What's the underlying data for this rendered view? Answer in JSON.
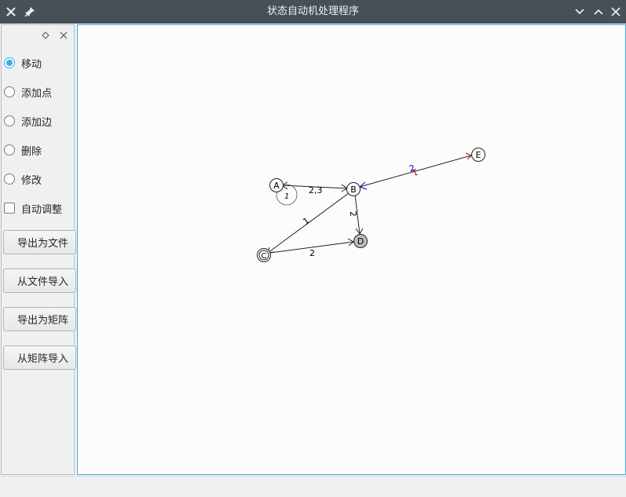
{
  "window": {
    "title": "状态自动机处理程序"
  },
  "icons": {
    "close": "close-icon",
    "pin": "pin-icon",
    "minimize": "chevron-down-icon",
    "maximize": "chevron-up-icon",
    "window_close": "close-icon",
    "dock_float": "diamond-icon",
    "dock_close": "close-icon"
  },
  "dock": {
    "modes": [
      {
        "label": "移动",
        "checked": true
      },
      {
        "label": "添加点",
        "checked": false
      },
      {
        "label": "添加边",
        "checked": false
      },
      {
        "label": "删除",
        "checked": false
      },
      {
        "label": "修改",
        "checked": false
      }
    ],
    "auto_adjust": {
      "label": "自动调整",
      "checked": false
    },
    "buttons": [
      "导出为文件",
      "从文件导入",
      "导出为矩阵",
      "从矩阵导入"
    ]
  },
  "graph": {
    "nodes": [
      {
        "id": "A",
        "label": "A",
        "filled": false,
        "accepting": false
      },
      {
        "id": "B",
        "label": "B",
        "filled": false,
        "accepting": false
      },
      {
        "id": "C",
        "label": "C",
        "filled": false,
        "accepting": true
      },
      {
        "id": "D",
        "label": "D",
        "filled": true,
        "accepting": false
      },
      {
        "id": "E",
        "label": "E",
        "filled": false,
        "accepting": false
      }
    ],
    "edges": [
      {
        "from": "A",
        "to": "B",
        "label": "2,3",
        "bidirectional": true
      },
      {
        "from": "A",
        "to": "A",
        "label": "1",
        "self_loop": true
      },
      {
        "from": "B",
        "to": "C",
        "label": "1"
      },
      {
        "from": "B",
        "to": "D",
        "label": "2"
      },
      {
        "from": "C",
        "to": "D",
        "label": "2"
      },
      {
        "from": "B",
        "to": "E",
        "label": "2",
        "bidirectional": true,
        "highlight_colors": [
          "#0000cc",
          "#cc0000"
        ],
        "reverse_label": "1"
      }
    ]
  },
  "colors": {
    "accent": "#3daee9",
    "titlebar": "#475057",
    "filled_node": "#bdbdbd"
  }
}
